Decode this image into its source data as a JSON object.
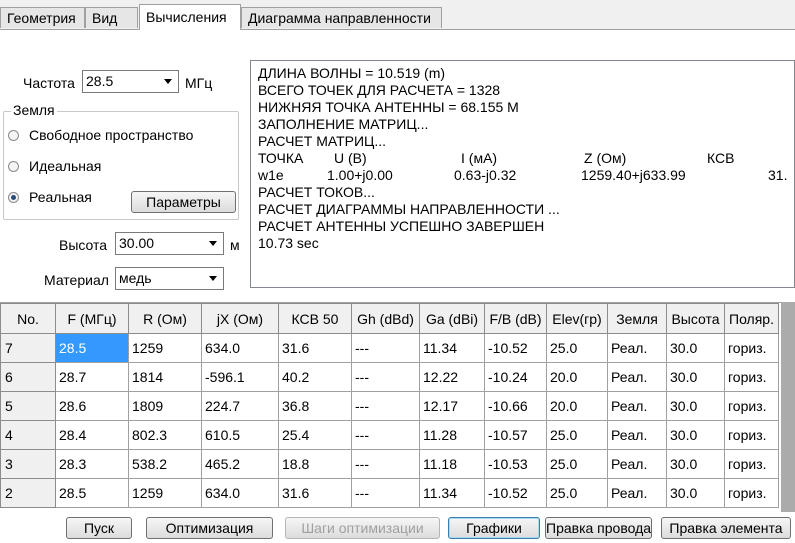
{
  "tabs": [
    {
      "label": "Геометрия"
    },
    {
      "label": "Вид"
    },
    {
      "label": "Вычисления"
    },
    {
      "label": "Диаграмма направленности"
    }
  ],
  "frequency": {
    "label": "Частота",
    "value": "28.5",
    "unit": "МГц"
  },
  "ground": {
    "title": "Земля",
    "options": [
      "Свободное пространство",
      "Идеальная",
      "Реальная"
    ],
    "selected": "Реальная",
    "params_button": "Параметры"
  },
  "height": {
    "label": "Высота",
    "value": "30.00",
    "unit": "м"
  },
  "material": {
    "label": "Материал",
    "value": "медь"
  },
  "output": {
    "lines": [
      "ДЛИНА ВОЛНЫ = 10.519 (m)",
      "ВСЕГО ТОЧЕК ДЛЯ РАСЧЕТА = 1328",
      "НИЖНЯЯ ТОЧКА АНТЕННЫ = 68.155 М",
      "ЗАПОЛНЕНИЕ МАТРИЦ...",
      "РАСЧЕТ МАТРИЦ..."
    ],
    "table_header": {
      "point": "ТОЧКА",
      "u": "U (В)",
      "i": "I (мА)",
      "z": "Z (Ом)",
      "swr": "КСВ"
    },
    "table_row": {
      "point": "w1e",
      "u": "1.00+j0.00",
      "i": "0.63-j0.32",
      "z": "1259.40+j633.99",
      "swr": "31."
    },
    "lines_after": [
      "РАСЧЕТ ТОКОВ...",
      "РАСЧЕТ ДИАГРАММЫ НАПРАВЛЕННОСТИ ...",
      "РАСЧЕТ АНТЕННЫ УСПЕШНО ЗАВЕРШЕН",
      "10.73 sec"
    ]
  },
  "grid": {
    "columns": [
      "No.",
      "F (МГц)",
      "R (Ом)",
      "jX (Ом)",
      "КСВ 50",
      "Gh (dBd)",
      "Ga (dBi)",
      "F/B (dB)",
      "Elev(гр)",
      "Земля",
      "Высота",
      "Поляр."
    ],
    "rows": [
      [
        "7",
        "28.5",
        "1259",
        "634.0",
        "31.6",
        "---",
        "11.34",
        "-10.52",
        "25.0",
        "Реал.",
        "30.0",
        "гориз."
      ],
      [
        "6",
        "28.7",
        "1814",
        "-596.1",
        "40.2",
        "---",
        "12.22",
        "-10.24",
        "20.0",
        "Реал.",
        "30.0",
        "гориз."
      ],
      [
        "5",
        "28.6",
        "1809",
        "224.7",
        "36.8",
        "---",
        "12.17",
        "-10.66",
        "20.0",
        "Реал.",
        "30.0",
        "гориз."
      ],
      [
        "4",
        "28.4",
        "802.3",
        "610.5",
        "25.4",
        "---",
        "11.28",
        "-10.57",
        "25.0",
        "Реал.",
        "30.0",
        "гориз."
      ],
      [
        "3",
        "28.3",
        "538.2",
        "465.2",
        "18.8",
        "---",
        "11.18",
        "-10.53",
        "25.0",
        "Реал.",
        "30.0",
        "гориз."
      ],
      [
        "2",
        "28.5",
        "1259",
        "634.0",
        "31.6",
        "---",
        "11.34",
        "-10.52",
        "25.0",
        "Реал.",
        "30.0",
        "гориз."
      ]
    ]
  },
  "buttons": {
    "start": "Пуск",
    "optimize": "Оптимизация",
    "opt_steps": "Шаги оптимизации",
    "graphs": "Графики",
    "edit_wire": "Правка провода",
    "edit_element": "Правка элемента"
  }
}
